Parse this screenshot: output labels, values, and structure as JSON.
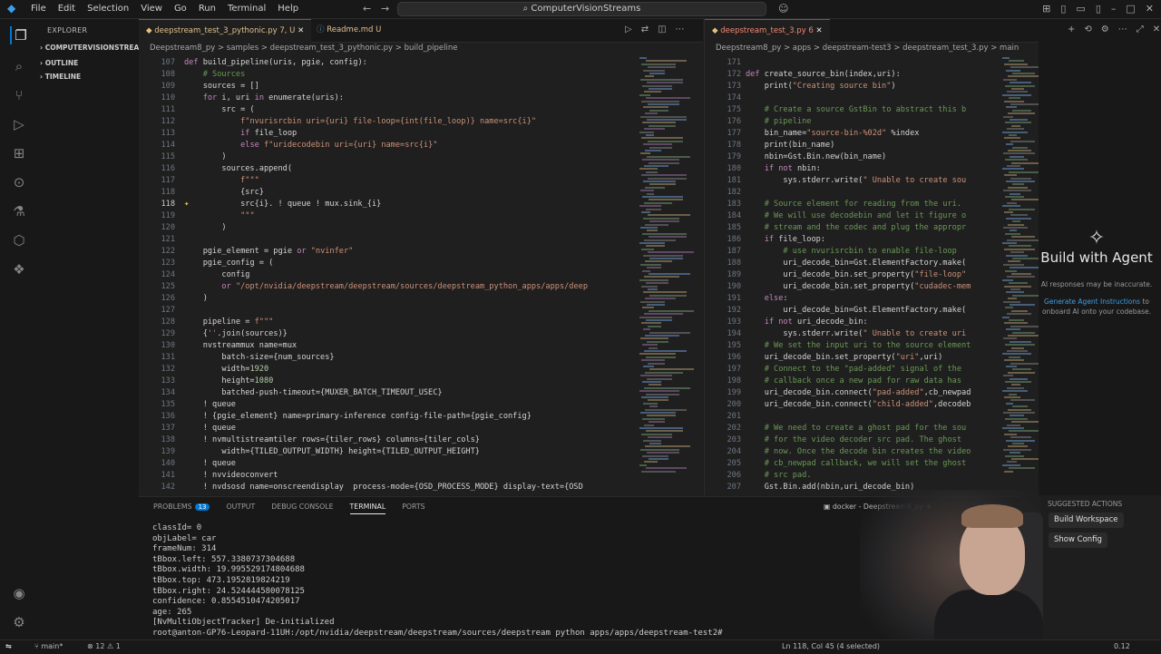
{
  "titlebar": {
    "menu": [
      "File",
      "Edit",
      "Selection",
      "View",
      "Go",
      "Run",
      "Terminal",
      "Help"
    ],
    "search": "ComputerVisionStreams"
  },
  "sidebar": {
    "header": "EXPLORER",
    "sections": [
      "COMPUTERVISIONSTREA...",
      "OUTLINE",
      "TIMELINE"
    ]
  },
  "editor1": {
    "tabs": [
      {
        "label": "deepstream_test_3_pythonic.py 7, U",
        "active": true
      },
      {
        "label": "Readme.md U",
        "active": false
      }
    ],
    "breadcrumb": "Deepstream8_py > samples > deepstream_test_3_pythonic.py > build_pipeline",
    "lines": [
      {
        "n": "107",
        "t": "def build_pipeline(uris, pgie, config):"
      },
      {
        "n": "108",
        "t": "    # Sources"
      },
      {
        "n": "109",
        "t": "    sources = []"
      },
      {
        "n": "110",
        "t": "    for i, uri in enumerate(uris):"
      },
      {
        "n": "111",
        "t": "        src = ("
      },
      {
        "n": "112",
        "t": "            f\"nvurisrcbin uri={uri} file-loop={int(file_loop)} name=src{i}\""
      },
      {
        "n": "113",
        "t": "            if file_loop"
      },
      {
        "n": "114",
        "t": "            else f\"uridecodebin uri={uri} name=src{i}\""
      },
      {
        "n": "115",
        "t": "        )"
      },
      {
        "n": "116",
        "t": "        sources.append("
      },
      {
        "n": "117",
        "t": "            f\"\"\""
      },
      {
        "n": "118",
        "t": "            {src}"
      },
      {
        "n": "118",
        "t": "            src{i}. ! queue ! mux.sink_{i}"
      },
      {
        "n": "119",
        "t": "            \"\"\""
      },
      {
        "n": "120",
        "t": "        )"
      },
      {
        "n": "121",
        "t": ""
      },
      {
        "n": "122",
        "t": "    pgie_element = pgie or \"nvinfer\""
      },
      {
        "n": "123",
        "t": "    pgie_config = ("
      },
      {
        "n": "124",
        "t": "        config"
      },
      {
        "n": "125",
        "t": "        or \"/opt/nvidia/deepstream/deepstream/sources/deepstream_python_apps/apps/deep"
      },
      {
        "n": "126",
        "t": "    )"
      },
      {
        "n": "127",
        "t": ""
      },
      {
        "n": "128",
        "t": "    pipeline = f\"\"\""
      },
      {
        "n": "129",
        "t": "    {''.join(sources)}"
      },
      {
        "n": "130",
        "t": "    nvstreammux name=mux"
      },
      {
        "n": "131",
        "t": "        batch-size={num_sources}"
      },
      {
        "n": "132",
        "t": "        width=1920"
      },
      {
        "n": "133",
        "t": "        height=1080"
      },
      {
        "n": "134",
        "t": "        batched-push-timeout={MUXER_BATCH_TIMEOUT_USEC}"
      },
      {
        "n": "135",
        "t": "    ! queue"
      },
      {
        "n": "136",
        "t": "    ! {pgie_element} name=primary-inference config-file-path={pgie_config}"
      },
      {
        "n": "137",
        "t": "    ! queue"
      },
      {
        "n": "138",
        "t": "    ! nvmultistreamtiler rows={tiler_rows} columns={tiler_cols}"
      },
      {
        "n": "139",
        "t": "        width={TILED_OUTPUT_WIDTH} height={TILED_OUTPUT_HEIGHT}"
      },
      {
        "n": "140",
        "t": "    ! queue"
      },
      {
        "n": "141",
        "t": "    ! nvvideoconvert"
      },
      {
        "n": "142",
        "t": "    ! nvdsosd name=onscreendisplay  process-mode={OSD_PROCESS_MODE} display-text={OSD"
      }
    ]
  },
  "editor2": {
    "tabs": [
      {
        "label": "deepstream_test_3.py 6",
        "active": true
      }
    ],
    "breadcrumb": "Deepstream8_py > apps > deepstream-test3 > deepstream_test_3.py > main",
    "lines": [
      {
        "n": "171",
        "t": ""
      },
      {
        "n": "172",
        "t": "def create_source_bin(index,uri):"
      },
      {
        "n": "173",
        "t": "    print(\"Creating source bin\")"
      },
      {
        "n": "174",
        "t": ""
      },
      {
        "n": "175",
        "t": "    # Create a source GstBin to abstract this b"
      },
      {
        "n": "176",
        "t": "    # pipeline"
      },
      {
        "n": "177",
        "t": "    bin_name=\"source-bin-%02d\" %index"
      },
      {
        "n": "178",
        "t": "    print(bin_name)"
      },
      {
        "n": "179",
        "t": "    nbin=Gst.Bin.new(bin_name)"
      },
      {
        "n": "180",
        "t": "    if not nbin:"
      },
      {
        "n": "181",
        "t": "        sys.stderr.write(\" Unable to create sou"
      },
      {
        "n": "182",
        "t": ""
      },
      {
        "n": "183",
        "t": "    # Source element for reading from the uri."
      },
      {
        "n": "184",
        "t": "    # We will use decodebin and let it figure o"
      },
      {
        "n": "185",
        "t": "    # stream and the codec and plug the appropr"
      },
      {
        "n": "186",
        "t": "    if file_loop:"
      },
      {
        "n": "187",
        "t": "        # use nvurisrcbin to enable file-loop"
      },
      {
        "n": "188",
        "t": "        uri_decode_bin=Gst.ElementFactory.make("
      },
      {
        "n": "189",
        "t": "        uri_decode_bin.set_property(\"file-loop\""
      },
      {
        "n": "190",
        "t": "        uri_decode_bin.set_property(\"cudadec-mem"
      },
      {
        "n": "191",
        "t": "    else:"
      },
      {
        "n": "192",
        "t": "        uri_decode_bin=Gst.ElementFactory.make("
      },
      {
        "n": "193",
        "t": "    if not uri_decode_bin:"
      },
      {
        "n": "194",
        "t": "        sys.stderr.write(\" Unable to create uri"
      },
      {
        "n": "195",
        "t": "    # We set the input uri to the source element"
      },
      {
        "n": "196",
        "t": "    uri_decode_bin.set_property(\"uri\",uri)"
      },
      {
        "n": "197",
        "t": "    # Connect to the \"pad-added\" signal of the"
      },
      {
        "n": "198",
        "t": "    # callback once a new pad for raw data has"
      },
      {
        "n": "199",
        "t": "    uri_decode_bin.connect(\"pad-added\",cb_newpad"
      },
      {
        "n": "200",
        "t": "    uri_decode_bin.connect(\"child-added\",decodeb"
      },
      {
        "n": "201",
        "t": ""
      },
      {
        "n": "202",
        "t": "    # We need to create a ghost pad for the sou"
      },
      {
        "n": "203",
        "t": "    # for the video decoder src pad. The ghost"
      },
      {
        "n": "204",
        "t": "    # now. Once the decode bin creates the video"
      },
      {
        "n": "205",
        "t": "    # cb_newpad callback, we will set the ghost"
      },
      {
        "n": "206",
        "t": "    # src pad."
      },
      {
        "n": "207",
        "t": "    Gst.Bin.add(nbin,uri_decode_bin)"
      }
    ]
  },
  "panel": {
    "tabs": [
      {
        "label": "PROBLEMS",
        "badge": "13"
      },
      {
        "label": "OUTPUT"
      },
      {
        "label": "DEBUG CONSOLE"
      },
      {
        "label": "TERMINAL"
      },
      {
        "label": "PORTS"
      }
    ],
    "terminal_title": "docker - Deepstream8_py",
    "terminal_lines": [
      "classId= 0",
      "objLabel= car",
      "frameNum: 314",
      "tBbox.left: 557.3380737304688",
      "tBbox.width: 19.995529174804688",
      "tBbox.top: 473.1952819824219",
      "tBbox.right: 24.524444580078125",
      "confidence: 0.8554510474205017",
      "age: 265",
      "[NvMultiObjectTracker] De-initialized",
      "root@anton-GP76-Leopard-11UH:/opt/nvidia/deepstream/deepstream/sources/deepstream python apps/apps/deepstream-test2# "
    ]
  },
  "chat": {
    "title": "Build with Agent",
    "subtitle": "AI responses may be inaccurate.",
    "link": "Generate Agent Instructions",
    "link_rest": "to onboard AI onto your codebase."
  },
  "suggested": {
    "header": "SUGGESTED ACTIONS",
    "actions": [
      "Build Workspace",
      "Show Config"
    ]
  },
  "statusbar": {
    "branch": "main*",
    "errors": "12",
    "warnings": "1",
    "cursor": "Ln 118, Col 45 (4 selected)",
    "right": "0.12"
  }
}
